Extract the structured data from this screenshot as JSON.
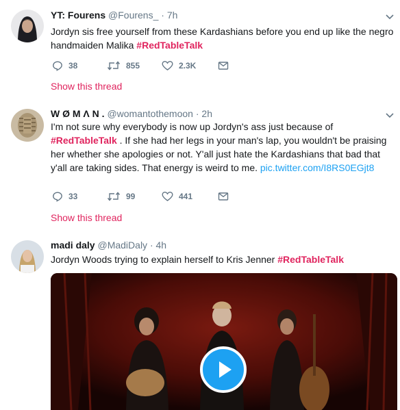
{
  "tweets": [
    {
      "name": "YT: Fourens",
      "handle": "@Fourens_",
      "dot": "·",
      "time": "7h",
      "text_plain": "Jordyn sis free yourself from these Kardashians before you end up like the negro handmaiden Malika ",
      "hashtag": "#RedTableTalk",
      "replies": "38",
      "retweets": "855",
      "likes": "2.3K",
      "show_thread": "Show this thread"
    },
    {
      "name": "W Ø M Λ N .",
      "handle": "@womantothemoon",
      "dot": "·",
      "time": "2h",
      "text_before": "I'm not sure why everybody is now up Jordyn's ass just because of ",
      "hashtag": "#RedTableTalk",
      "text_after": " . If she had her legs in your man's lap, you wouldn't be praising her whether she apologies or not. Y'all just hate the Kardashians that bad that y'all are taking sides. That energy is weird to me. ",
      "link": "pic.twitter.com/I8RS0EGjt8",
      "replies": "33",
      "retweets": "99",
      "likes": "441",
      "show_thread": "Show this thread"
    },
    {
      "name": "madi daly",
      "handle": "@MadiDaly",
      "dot": "·",
      "time": "4h",
      "text_plain": "Jordyn Woods trying to explain herself to Kris Jenner ",
      "hashtag": "#RedTableTalk"
    }
  ],
  "colors": {
    "hashtag": "#e0245e",
    "link": "#1da1f2",
    "secondary": "#657786",
    "play": "#1da1f2"
  },
  "icons": [
    "reply-icon",
    "retweet-icon",
    "like-icon",
    "message-icon",
    "chevron-down-icon",
    "play-icon"
  ]
}
